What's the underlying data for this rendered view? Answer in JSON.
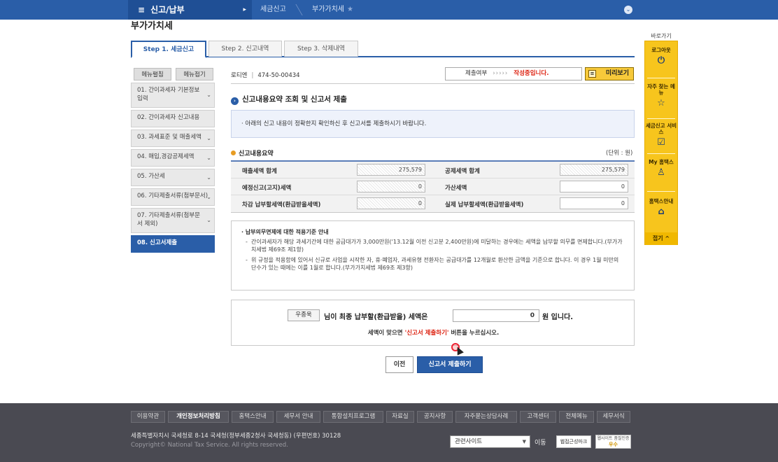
{
  "topbar": {
    "menu_label": "신고/납부",
    "menu_icon": "hamburger-icon",
    "crumb1": "세금신고",
    "crumb2": "부가가치세",
    "star_icon": "star-icon",
    "expand_icon": "chevron-down-icon"
  },
  "page_title": "부가가치세",
  "tabs": [
    {
      "label": "Step 1. 세금신고"
    },
    {
      "label": "Step 2. 신고내역"
    },
    {
      "label": "Step 3. 삭제내역"
    }
  ],
  "left_menu": {
    "top_buttons": [
      "메뉴펼침",
      "메뉴접기"
    ],
    "items": [
      {
        "label": "01. 간이과세자 기본정보 입력"
      },
      {
        "label": "02. 간이과세자 신고내용"
      },
      {
        "label": "03. 과세표준 및 매출세액"
      },
      {
        "label": "04. 매입,경감공제세액"
      },
      {
        "label": "05. 가산세"
      },
      {
        "label": "06. 기타제출서류(첨부문서)"
      },
      {
        "label": "07. 기타제출서류(첨부문서 제외)"
      },
      {
        "label": "08. 신고서제출"
      }
    ]
  },
  "header": {
    "biz_label": "로티엔",
    "biz_number": "474-50-00434",
    "status_label": "제출여부",
    "status_dots": "›››››",
    "status_value": "작성중입니다.",
    "preview_label": "미리보기"
  },
  "section_title": "신고내용요약 조회 및 신고서 제출",
  "notice_text": "· 아래의 신고 내용이 정확한지 확인하신 후 신고서를 제출하시기 바랍니다.",
  "summary": {
    "title": "신고내용요약",
    "unit": "(단위 : 원)",
    "rows": [
      {
        "l1": "매출세액 합계",
        "v1": "275,579",
        "l2": "공제세액 합계",
        "v2": "275,579"
      },
      {
        "l1": "예정신고(고지)세액",
        "v1": "0",
        "l2": "가산세액",
        "v2": "0"
      },
      {
        "l1": "차감 납부할세액(환급받을세액)",
        "v1": "0",
        "l2": "실제 납부할세액(환급받을세액)",
        "v2": "0"
      }
    ]
  },
  "guide": {
    "title": "· 납부의무면제에 대한 적용기준 안내",
    "items": [
      "간이과세자가 해당 과세기간에 대한 공급대가가 3,000만원('13.12월 이전 신고분 2,400만원)에 미달하는 경우에는 세액을 납부할 의무를 면제합니다.(부가가치세법 제69조 제1항)",
      "위 규정을 적용함에 있어서 신규로 사업을 시작한 자, 휴·폐업자, 과세유형 전환자는 공급대가를 12개월로 환산한 금액을 기준으로 합니다. 이 경우 1월 미만의 단수가 있는 때에는 이를 1월로 합니다.(부가가치세법 제69조 제3항)"
    ]
  },
  "final": {
    "name": "우종욱",
    "text1": "님이 최종 납부할(환급받을) 세액은",
    "amount": "0",
    "text2": "원 입니다.",
    "confirm_prefix": "세액이 맞으면",
    "confirm_highlight": "'신고서 제출하기'",
    "confirm_suffix": "버튼을 누르십시오."
  },
  "buttons": {
    "prev": "이전",
    "submit": "신고서 제출하기"
  },
  "quick": {
    "title": "바로가기",
    "items": [
      {
        "label": "로그아웃",
        "icon": "logout-icon"
      },
      {
        "label": "자주 찾는 메뉴",
        "icon": "star-icon"
      },
      {
        "label": "세금신고 서비스",
        "icon": "checkbox-icon"
      },
      {
        "label": "My 홈택스",
        "icon": "person-icon"
      },
      {
        "label": "홈택스안내",
        "icon": "home-icon"
      }
    ],
    "close": "접기 ^"
  },
  "footer": {
    "links": [
      "이용약관",
      "개인정보처리방침",
      "홈택스안내",
      "세무서 안내",
      "통합설치프로그램",
      "자료실",
      "공지사항",
      "자주묻는상담사례",
      "고객센터",
      "전체메뉴",
      "세무서식"
    ],
    "address": "세종특별자치시 국세청로 8-14 국세청(정부세종2청사 국세청동) (우편번호) 30128",
    "copyright": "Copyright© National Tax Service. All rights reserved.",
    "select_value": "관련사이트",
    "move_label": "이동",
    "badge1": "웹접근성마크",
    "badge2_top": "웹사이트 품질인증",
    "badge2_bottom": "우수"
  },
  "colors": {
    "brand_blue": "#2a5ea8",
    "quick_yellow": "#f7c51d",
    "status_red": "#dd2211",
    "footer_bg": "#4a4a52"
  }
}
